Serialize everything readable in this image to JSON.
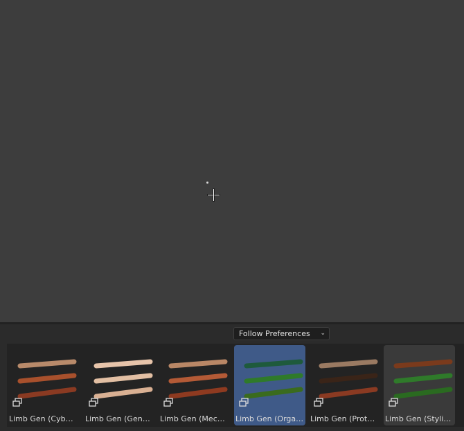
{
  "asset_browser": {
    "import_method": "Follow Preferences",
    "assets": [
      {
        "label": "Limb Gen (Cybern…",
        "colors": [
          "#b88a6a",
          "#a8502c",
          "#8a3a22"
        ]
      },
      {
        "label": "Limb Gen (Generic)",
        "colors": [
          "#e7c4aa",
          "#e2bfa3",
          "#d9b093"
        ]
      },
      {
        "label": "Limb Gen (Mecha)",
        "colors": [
          "#b98766",
          "#b45a36",
          "#8e3a20"
        ]
      },
      {
        "label": "Limb Gen (Organic)",
        "colors": [
          "#1e5a3c",
          "#2f7a2a",
          "#3a6b1e"
        ]
      },
      {
        "label": "Limb Gen (Prothe…",
        "colors": [
          "#9a7a62",
          "#3a2418",
          "#8a3a22"
        ]
      },
      {
        "label": "Limb Gen (Stylize…",
        "colors": [
          "#7a3a1c",
          "#2f7a2a",
          "#2a6a20"
        ]
      }
    ]
  }
}
